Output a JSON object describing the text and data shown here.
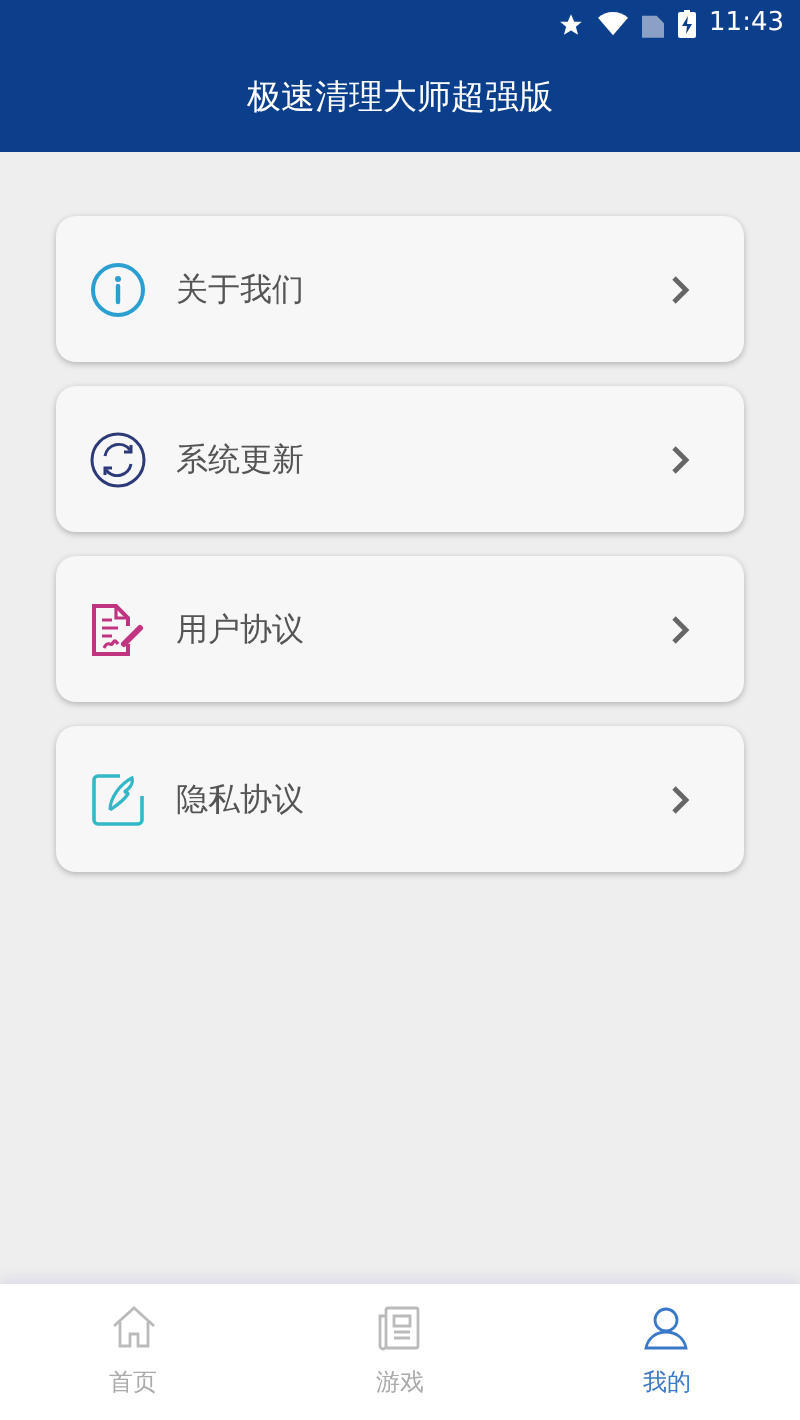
{
  "status_bar": {
    "time": "11:43"
  },
  "header": {
    "title": "极速清理大师超强版"
  },
  "menu": [
    {
      "kind": "info",
      "label": "关于我们"
    },
    {
      "kind": "update",
      "label": "系统更新"
    },
    {
      "kind": "contract",
      "label": "用户协议"
    },
    {
      "kind": "note",
      "label": "隐私协议"
    }
  ],
  "tabs": [
    {
      "kind": "home",
      "label": "首页",
      "selected": false
    },
    {
      "kind": "news",
      "label": "游戏",
      "selected": false
    },
    {
      "kind": "user",
      "label": "我的",
      "selected": true
    }
  ]
}
